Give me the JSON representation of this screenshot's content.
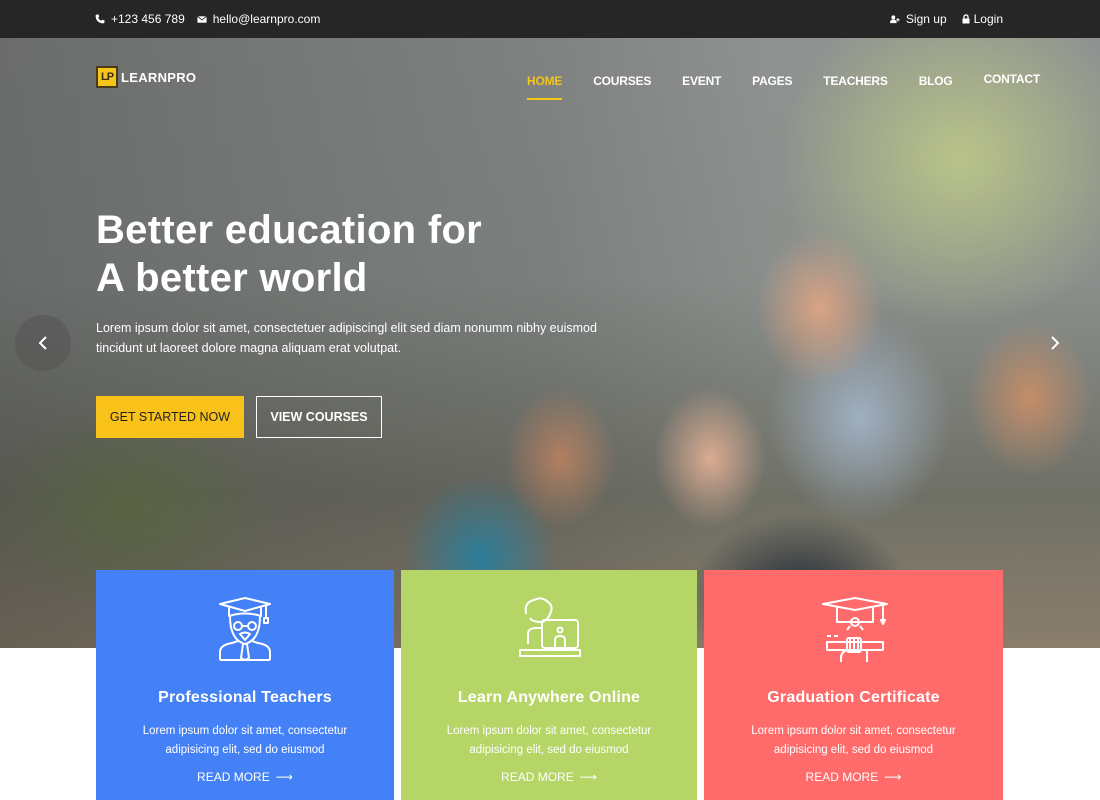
{
  "topbar": {
    "phone": "+123 456 789",
    "email": "hello@learnpro.com",
    "signup": "Sign up",
    "login": "Login",
    "icons": {
      "phone": "phone-icon",
      "email": "envelope-icon",
      "signup": "user-plus-icon",
      "login": "lock-icon"
    }
  },
  "brand": {
    "mark": "LP",
    "name": "LEARNPRO",
    "accent": "#f5c518"
  },
  "nav": {
    "items": [
      {
        "label": "HOME",
        "active": true
      },
      {
        "label": "COURSES",
        "active": false
      },
      {
        "label": "EVENT",
        "active": false
      },
      {
        "label": "PAGES",
        "active": false
      },
      {
        "label": "TEACHERS",
        "active": false
      },
      {
        "label": "BLOG",
        "active": false
      },
      {
        "label": "CONTACT",
        "active": false
      }
    ]
  },
  "hero": {
    "headline_line1": "Better education for",
    "headline_line2": "A better world",
    "subtext": "Lorem ipsum dolor sit amet, consectetuer adipiscingl elit sed diam nonumm nibhy euismod tincidunt ut laoreet dolore magna aliquam erat volutpat.",
    "primary_button": "GET STARTED NOW",
    "secondary_button": "VIEW COURSES",
    "prev_arrow": "‹",
    "next_arrow": "›",
    "image_description": "Four smiling students gathered around a laptop outdoors"
  },
  "features": [
    {
      "title": "Professional Teachers",
      "desc_line1": "Lorem ipsum dolor sit amet, consectetur",
      "desc_line2": "adipisicing elit, sed do eiusmod",
      "link": "READ MORE",
      "icon": "teacher-icon",
      "color": "#4581f6"
    },
    {
      "title": "Learn Anywhere Online",
      "desc_line1": "Lorem ipsum dolor sit amet, consectetur",
      "desc_line2": "adipisicing elit, sed do eiusmod",
      "link": "READ MORE",
      "icon": "online-learning-icon",
      "color": "#b5d566"
    },
    {
      "title": "Graduation Certificate",
      "desc_line1": "Lorem ipsum dolor sit amet, consectetur",
      "desc_line2": "adipisicing elit, sed do eiusmod",
      "link": "READ MORE",
      "icon": "graduation-certificate-icon",
      "color": "#ff6b6b"
    }
  ],
  "arrow_glyph": "⟶"
}
